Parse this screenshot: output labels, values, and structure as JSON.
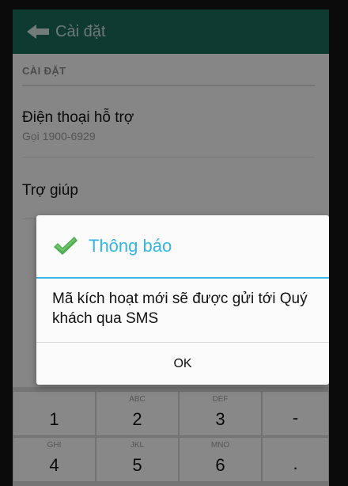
{
  "appbar": {
    "title": "Cài đặt",
    "back_icon": "back-arrow-icon"
  },
  "settings": {
    "section_header": "CÀI ĐẶT",
    "items": [
      {
        "title": "Điện thoại hỗ trợ",
        "subtitle": "Gọi 1900-6929"
      },
      {
        "title": "Trợ giúp"
      }
    ]
  },
  "dialog": {
    "icon": "checkmark-icon",
    "title": "Thông báo",
    "message": "Mã kích hoạt mới sẽ được gửi tới Quý khách qua SMS",
    "ok_label": "OK"
  },
  "keyboard": {
    "rows": [
      [
        {
          "letters": "",
          "digit": "1"
        },
        {
          "letters": "ABC",
          "digit": "2"
        },
        {
          "letters": "DEF",
          "digit": "3"
        },
        {
          "letters": "",
          "digit": "-"
        }
      ],
      [
        {
          "letters": "GHI",
          "digit": "4"
        },
        {
          "letters": "JKL",
          "digit": "5"
        },
        {
          "letters": "MNO",
          "digit": "6"
        },
        {
          "letters": "",
          "digit": "."
        }
      ]
    ]
  },
  "colors": {
    "appbar": "#1d6a5a",
    "dialog_accent": "#33b5e5",
    "check_green": "#4caf50"
  }
}
